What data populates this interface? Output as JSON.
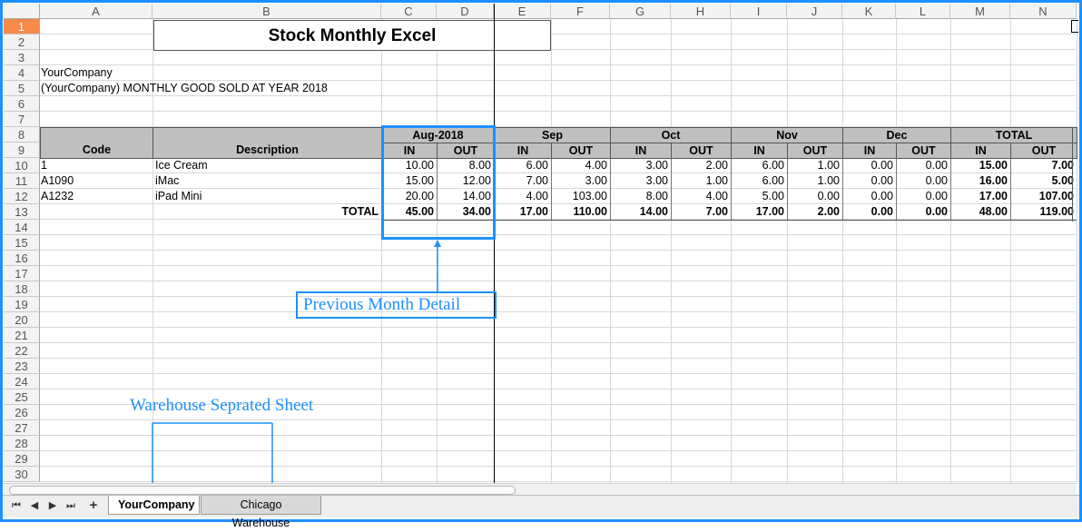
{
  "columns": [
    "A",
    "B",
    "C",
    "D",
    "E",
    "F",
    "G",
    "H",
    "I",
    "J",
    "K",
    "L",
    "M",
    "N"
  ],
  "rows": [
    "1",
    "2",
    "3",
    "4",
    "5",
    "6",
    "7",
    "8",
    "9",
    "10",
    "11",
    "12",
    "13",
    "14",
    "15",
    "16",
    "17",
    "18",
    "19",
    "20",
    "21",
    "22",
    "23",
    "24",
    "25",
    "26",
    "27",
    "28",
    "29",
    "30"
  ],
  "sheet": {
    "title": "Stock Monthly Excel",
    "company": "YourCompany",
    "subtitle": "(YourCompany) MONTHLY GOOD SOLD AT YEAR 2018",
    "header_code": "Code",
    "header_description": "Description",
    "months": [
      "Aug-2018",
      "Sep",
      "Oct",
      "Nov",
      "Dec",
      "TOTAL"
    ],
    "in_label": "IN",
    "out_label": "OUT",
    "items": [
      {
        "code": "1",
        "description": "Ice Cream",
        "values": [
          "10.00",
          "8.00",
          "6.00",
          "4.00",
          "3.00",
          "2.00",
          "6.00",
          "1.00",
          "0.00",
          "0.00",
          "15.00",
          "7.00"
        ]
      },
      {
        "code": "A1090",
        "description": "iMac",
        "values": [
          "15.00",
          "12.00",
          "7.00",
          "3.00",
          "3.00",
          "1.00",
          "6.00",
          "1.00",
          "0.00",
          "0.00",
          "16.00",
          "5.00"
        ]
      },
      {
        "code": "A1232",
        "description": "iPad Mini",
        "values": [
          "20.00",
          "14.00",
          "4.00",
          "103.00",
          "8.00",
          "4.00",
          "5.00",
          "0.00",
          "0.00",
          "0.00",
          "17.00",
          "107.00"
        ]
      }
    ],
    "total_label": "TOTAL",
    "totals": [
      "45.00",
      "34.00",
      "17.00",
      "110.00",
      "14.00",
      "7.00",
      "17.00",
      "2.00",
      "0.00",
      "0.00",
      "48.00",
      "119.00"
    ]
  },
  "annotations": {
    "previous_month": "Previous Month Detail",
    "warehouse": "Warehouse Seprated Sheet"
  },
  "tabs": [
    "YourCompany",
    "Chicago Warehouse"
  ],
  "active_tab": "YourCompany",
  "colors": {
    "accent": "#1e90ff",
    "header_fill": "#c0c0c0",
    "active_row": "#f58a4a"
  }
}
